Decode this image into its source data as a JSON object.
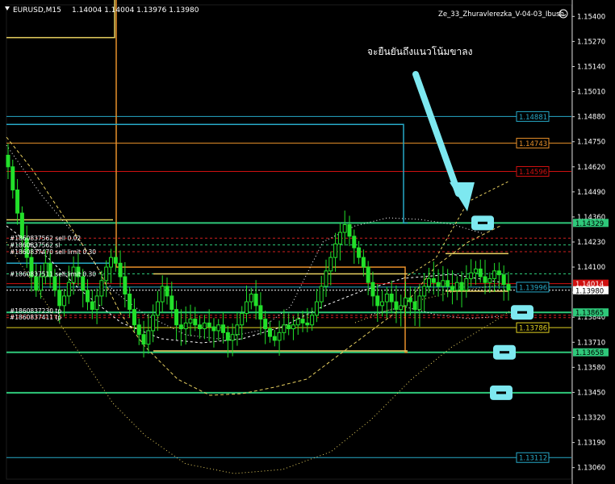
{
  "header": {
    "symbol": "EURUSD,M15",
    "ohlc": "1.14004 1.14004 1.13976 1.13980",
    "indicator": "Ze_33_Zhuravlerezka_V-04-03_Ibush"
  },
  "annotation": {
    "text": "จะยืนยันถึงแนวโน้มขาลง"
  },
  "price_axis": {
    "ticks": [
      "1.15400",
      "1.15270",
      "1.15140",
      "1.15010",
      "1.14880",
      "1.14750",
      "1.14620",
      "1.14490",
      "1.14360",
      "1.14230",
      "1.14100",
      "1.13970",
      "1.13840",
      "1.13710",
      "1.13580",
      "1.13450",
      "1.13320",
      "1.13190",
      "1.13060"
    ],
    "min": 1.13,
    "max": 1.1546,
    "highlighted": [
      {
        "label": "1.14329",
        "value": 1.14329,
        "bg": "#2ec87a",
        "fg": "#000000"
      },
      {
        "label": "1.14014",
        "value": 1.14014,
        "bg": "#d01010",
        "fg": "#ffffff"
      },
      {
        "label": "1.13980",
        "value": 1.1398,
        "bg": "#ffffff",
        "fg": "#000000"
      },
      {
        "label": "1.13865",
        "value": 1.13865,
        "bg": "#2ec87a",
        "fg": "#000000"
      },
      {
        "label": "1.13658",
        "value": 1.13658,
        "bg": "#2ec87a",
        "fg": "#000000"
      }
    ]
  },
  "level_labels": [
    {
      "label": "1.14881",
      "value": 1.14881,
      "color": "#27a9c8"
    },
    {
      "label": "1.14743",
      "value": 1.14743,
      "color": "#e8902a"
    },
    {
      "label": "1.14596",
      "value": 1.14596,
      "color": "#d01010"
    },
    {
      "label": "1.13996",
      "value": 1.13996,
      "color": "#27a9c8"
    },
    {
      "label": "1.13786",
      "value": 1.13786,
      "color": "#e0d020"
    },
    {
      "label": "1.13112",
      "value": 1.13112,
      "color": "#27a9c8"
    }
  ],
  "order_labels": [
    {
      "text": "#1860837562 sell 0.02",
      "value": 1.1425
    },
    {
      "text": "#1860837562 sl",
      "value": 1.14215
    },
    {
      "text": "#1860837470 sell limit 0.30",
      "value": 1.1418
    },
    {
      "text": "#1860837511 sell limit 0.30",
      "value": 1.14065
    },
    {
      "text": "#1860837230 tp",
      "value": 1.13875
    },
    {
      "text": "#1860837411 tp",
      "value": 1.1384
    }
  ],
  "chart_data": {
    "type": "candlestick",
    "symbol": "EURUSD",
    "timeframe": "M15",
    "ylim": [
      1.13,
      1.1546
    ],
    "close_path": [
      1.1462,
      1.145,
      1.1438,
      1.1425,
      1.1415,
      1.1405,
      1.1398,
      1.1405,
      1.1412,
      1.1405,
      1.1398,
      1.139,
      1.1395,
      1.1402,
      1.141,
      1.1405,
      1.1398,
      1.1392,
      1.1388,
      1.1395,
      1.1403,
      1.141,
      1.1415,
      1.1412,
      1.1405,
      1.1396,
      1.1388,
      1.138,
      1.1375,
      1.137,
      1.1377,
      1.1385,
      1.1392,
      1.14,
      1.1395,
      1.1388,
      1.138,
      1.1378,
      1.1381,
      1.1383,
      1.138,
      1.1378,
      1.1381,
      1.1379,
      1.1377,
      1.138,
      1.1376,
      1.1372,
      1.1375,
      1.138,
      1.1386,
      1.1392,
      1.1396,
      1.139,
      1.1383,
      1.1378,
      1.1374,
      1.1372,
      1.1376,
      1.138,
      1.1378,
      1.138,
      1.1383,
      1.1381,
      1.138,
      1.1385,
      1.1392,
      1.14,
      1.1408,
      1.1415,
      1.1422,
      1.1428,
      1.1432,
      1.1426,
      1.142,
      1.1415,
      1.141,
      1.1402,
      1.1395,
      1.139,
      1.1392,
      1.1396,
      1.1392,
      1.1388,
      1.139,
      1.1394,
      1.1392,
      1.1388,
      1.1395,
      1.14,
      1.1404,
      1.1402,
      1.14,
      1.1403,
      1.14,
      1.1398,
      1.1402,
      1.1398,
      1.1404,
      1.1407,
      1.1409,
      1.1405,
      1.1402,
      1.1404,
      1.1408,
      1.1406,
      1.1401,
      1.1398
    ],
    "levels": [
      1.14881,
      1.14743,
      1.14596,
      1.14329,
      1.13996,
      1.13865,
      1.13786,
      1.13658,
      1.13448,
      1.13112
    ]
  },
  "colors": {
    "candle": "#22e02a",
    "grid": "#151515",
    "text": "#ffffff",
    "cyan_arrow": "#7de8f0"
  }
}
